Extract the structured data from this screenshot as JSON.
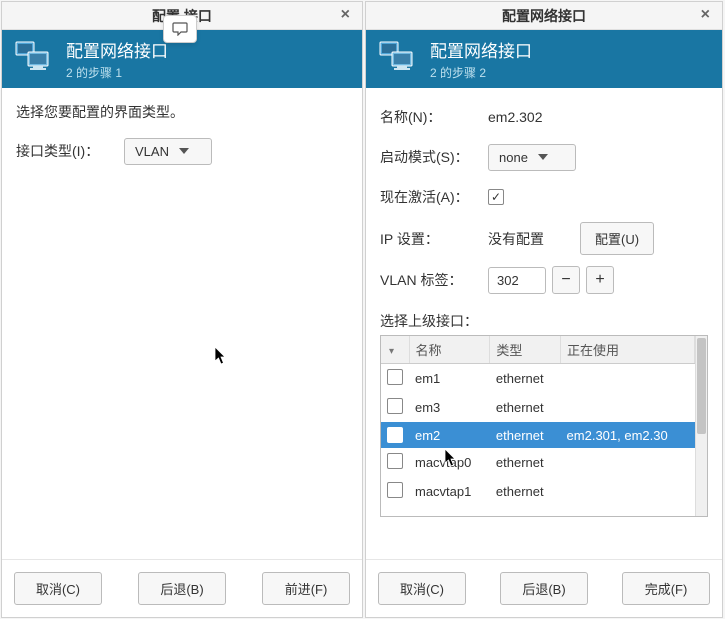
{
  "left": {
    "window_title": "配置        接口",
    "header_title": "配置网络接口",
    "header_sub": "2 的步骤 1",
    "prompt": "选择您要配置的界面类型。",
    "iface_type_label": "接口类型(I)：",
    "iface_type_value": "VLAN",
    "buttons": {
      "cancel": "取消(C)",
      "back": "后退(B)",
      "next": "前进(F)"
    }
  },
  "right": {
    "window_title": "配置网络接口",
    "header_title": "配置网络接口",
    "header_sub": "2 的步骤 2",
    "name_label": "名称(N)：",
    "name_value": "em2.302",
    "start_mode_label": "启动模式(S)：",
    "start_mode_value": "none",
    "activate_now_label": "现在激活(A)：",
    "activate_now_checked": true,
    "ip_settings_label": "IP 设置：",
    "ip_settings_value": "没有配置",
    "ip_configure_btn": "配置(U)",
    "vlan_tag_label": "VLAN 标签：",
    "vlan_tag_value": "302",
    "parent_iface_label": "选择上级接口：",
    "table_headers": {
      "check": "",
      "name": "名称",
      "type": "类型",
      "in_use": "正在使用"
    },
    "table_rows": [
      {
        "checked": false,
        "name": "em1",
        "type": "ethernet",
        "in_use": ""
      },
      {
        "checked": false,
        "name": "em3",
        "type": "ethernet",
        "in_use": ""
      },
      {
        "checked": true,
        "name": "em2",
        "type": "ethernet",
        "in_use": "em2.301, em2.30"
      },
      {
        "checked": false,
        "name": "macvtap0",
        "type": "ethernet",
        "in_use": ""
      },
      {
        "checked": false,
        "name": "macvtap1",
        "type": "ethernet",
        "in_use": ""
      }
    ],
    "buttons": {
      "cancel": "取消(C)",
      "back": "后退(B)",
      "finish": "完成(F)"
    }
  }
}
